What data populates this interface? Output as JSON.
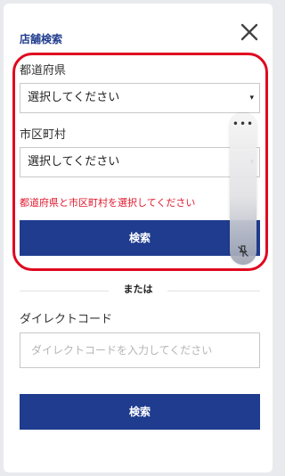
{
  "header": {
    "title": "店舗検索",
    "close_icon": "close-icon"
  },
  "prefecture": {
    "label": "都道府県",
    "value": "選択してください",
    "caret": "▾"
  },
  "city": {
    "label": "市区町村",
    "value": "選択してください",
    "caret": "▾"
  },
  "error_message": "都道府県と市区町村を選択してください",
  "search_button_1": {
    "label": "検索"
  },
  "divider": {
    "label": "または"
  },
  "direct_code": {
    "label": "ダイレクトコード",
    "placeholder": "ダイレクトコードを入力してください"
  },
  "search_button_2": {
    "label": "検索"
  },
  "overlay": {
    "menu_icon": "more-horizontal-icon",
    "menu_glyph": "•••",
    "pin_icon": "pin-off-icon"
  },
  "colors": {
    "brand": "#1f3c8e",
    "error": "#e0182d",
    "highlight": "#e0081f"
  }
}
